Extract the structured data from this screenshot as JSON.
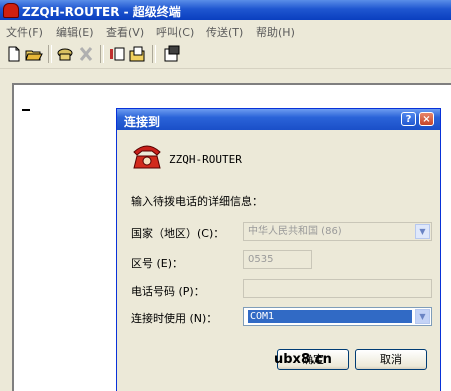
{
  "window": {
    "title": "ZZQH-ROUTER - 超级终端"
  },
  "menu": [
    {
      "label": "文件(F)"
    },
    {
      "label": "编辑(E)"
    },
    {
      "label": "查看(V)"
    },
    {
      "label": "呼叫(C)"
    },
    {
      "label": "传送(T)"
    },
    {
      "label": "帮助(H)"
    }
  ],
  "toolbar": {
    "icons": [
      "new-icon",
      "open-icon",
      "call-icon",
      "disconnect-icon",
      "send-icon",
      "receive-icon",
      "properties-icon"
    ]
  },
  "dialog": {
    "title": "连接到",
    "help_label": "?",
    "close_label": "×",
    "connection_name": "ZZQH-ROUTER",
    "prompt": "输入待拨电话的详细信息：",
    "country_label": "国家（地区）(C)：",
    "country_value": "中华人民共和国 (86)",
    "area_label": "区号 (E)：",
    "area_value": "0535",
    "phone_label": "电话号码 (P)：",
    "phone_value": "",
    "connect_label": "连接时使用 (N)：",
    "connect_value": "COM1",
    "ok_label": "确定",
    "cancel_label": "取消"
  },
  "watermark": "ubx8.cn",
  "colors": {
    "title_bar": "#1f56d0",
    "selection": "#316ac5",
    "dialog_bg": "#ece9d8"
  }
}
